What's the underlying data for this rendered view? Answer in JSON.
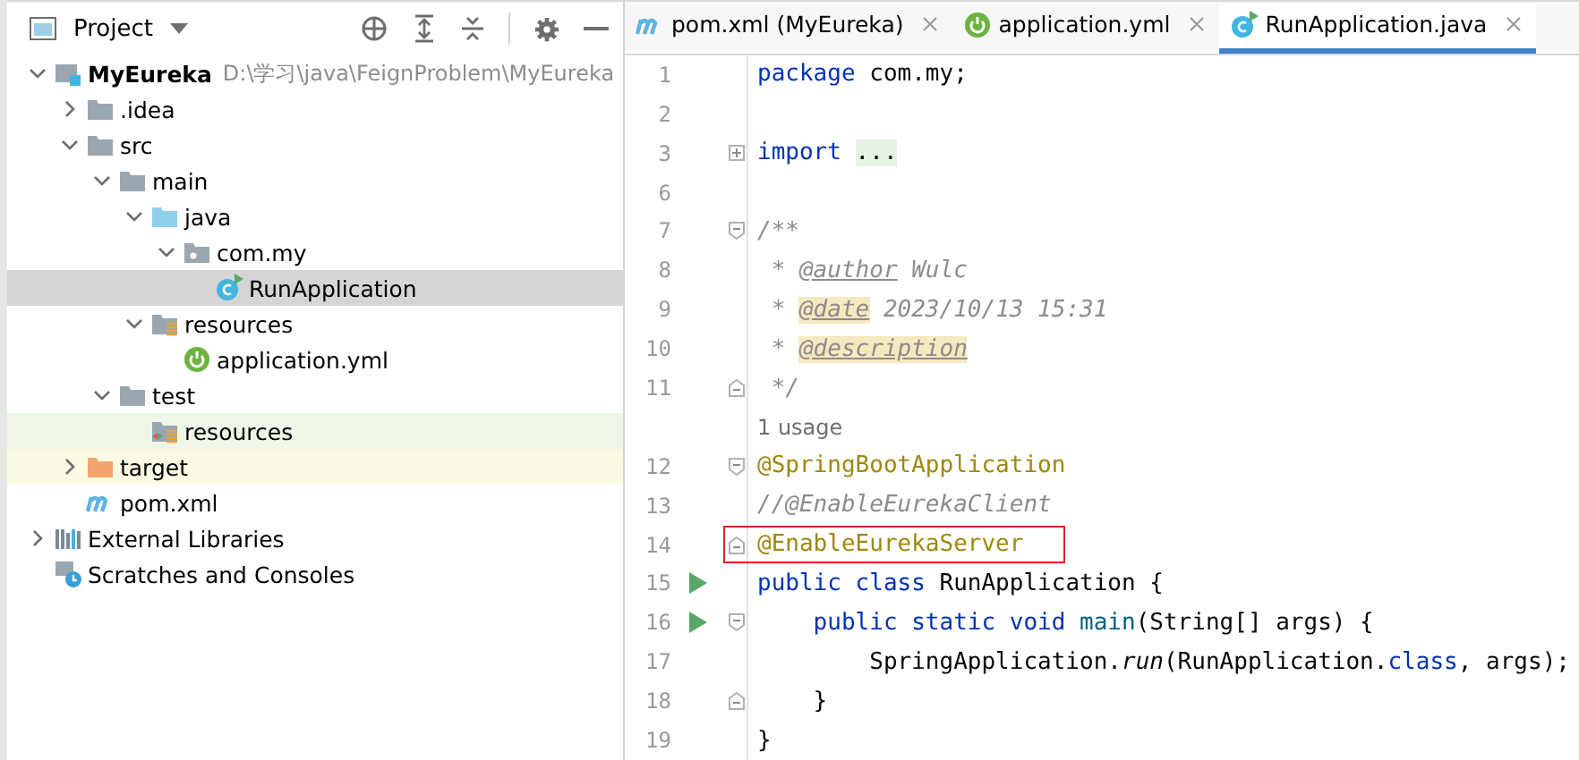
{
  "project_panel": {
    "title": "Project",
    "tree": [
      {
        "label": "MyEureka",
        "kind": "module",
        "hint": "D:\\学习\\java\\FeignProblem\\MyEureka",
        "expanded": true,
        "selected": false,
        "children": [
          {
            "label": ".idea",
            "kind": "folder",
            "expanded": false,
            "selected": false
          },
          {
            "label": "src",
            "kind": "folder",
            "expanded": true,
            "selected": false,
            "children": [
              {
                "label": "main",
                "kind": "folder",
                "expanded": true,
                "selected": false,
                "children": [
                  {
                    "label": "java",
                    "kind": "source-folder",
                    "expanded": true,
                    "selected": false,
                    "children": [
                      {
                        "label": "com.my",
                        "kind": "package",
                        "expanded": true,
                        "selected": false,
                        "children": [
                          {
                            "label": "RunApplication",
                            "kind": "class",
                            "selected": true
                          }
                        ]
                      }
                    ]
                  },
                  {
                    "label": "resources",
                    "kind": "resources",
                    "expanded": true,
                    "selected": false,
                    "children": [
                      {
                        "label": "application.yml",
                        "kind": "spring",
                        "selected": false
                      }
                    ]
                  }
                ]
              },
              {
                "label": "test",
                "kind": "folder",
                "expanded": true,
                "selected": false,
                "children": [
                  {
                    "label": "resources",
                    "kind": "test-resources",
                    "selected": false
                  }
                ]
              }
            ]
          },
          {
            "label": "target",
            "kind": "excluded",
            "expanded": false,
            "selected": false
          },
          {
            "label": "pom.xml",
            "kind": "maven",
            "selected": false
          }
        ]
      },
      {
        "label": "External Libraries",
        "kind": "libraries",
        "expanded": false,
        "selected": false
      },
      {
        "label": "Scratches and Consoles",
        "kind": "scratches",
        "selected": false
      }
    ]
  },
  "tabs": [
    {
      "label": "pom.xml (MyEureka)",
      "kind": "maven",
      "selected": false
    },
    {
      "label": "application.yml",
      "kind": "spring",
      "selected": false
    },
    {
      "label": "RunApplication.java",
      "kind": "class",
      "selected": true
    }
  ],
  "editor": {
    "lines": [
      {
        "kind": "code",
        "number": "1",
        "run": false,
        "fold_start": false,
        "fold_end": false,
        "tokens": [
          {
            "kind": "keyword",
            "text": "package"
          },
          {
            "kind": "plain",
            "text": " com.my;"
          }
        ]
      },
      {
        "kind": "code",
        "number": "2",
        "run": false,
        "fold_start": false,
        "fold_end": false
      },
      {
        "kind": "code",
        "number": "3",
        "run": false,
        "fold_start": true,
        "fold_end": false,
        "collapsed": true,
        "tokens": [
          {
            "kind": "keyword",
            "text": "import "
          },
          {
            "kind": "folded",
            "text": "..."
          }
        ]
      },
      {
        "kind": "code",
        "number": "6",
        "run": false,
        "fold_start": false,
        "fold_end": false
      },
      {
        "kind": "code",
        "number": "7",
        "run": false,
        "fold_start": true,
        "fold_end": false,
        "collapsed": false,
        "tokens": [
          {
            "kind": "comment",
            "text": "/**"
          }
        ]
      },
      {
        "kind": "code",
        "number": "8",
        "run": false,
        "fold_start": false,
        "fold_end": false,
        "tokens": [
          {
            "kind": "comment",
            "text": " * "
          },
          {
            "kind": "doc-tag",
            "text": "@author"
          },
          {
            "kind": "comment",
            "text": " Wulc"
          }
        ]
      },
      {
        "kind": "code",
        "number": "9",
        "run": false,
        "fold_start": false,
        "fold_end": false,
        "tokens": [
          {
            "kind": "comment",
            "text": " * "
          },
          {
            "kind": "doc-tag-marked",
            "text": "@date"
          },
          {
            "kind": "comment",
            "text": " 2023/10/13 15:31"
          }
        ]
      },
      {
        "kind": "code",
        "number": "10",
        "run": false,
        "fold_start": false,
        "fold_end": false,
        "tokens": [
          {
            "kind": "comment",
            "text": " * "
          },
          {
            "kind": "doc-tag-marked",
            "text": "@description"
          }
        ]
      },
      {
        "kind": "code",
        "number": "11",
        "run": false,
        "fold_start": false,
        "fold_end": true,
        "tokens": [
          {
            "kind": "comment",
            "text": " */"
          }
        ]
      },
      {
        "kind": "hint",
        "text": "1 usage"
      },
      {
        "kind": "code",
        "number": "12",
        "run": false,
        "fold_start": true,
        "fold_end": false,
        "collapsed": false,
        "tokens": [
          {
            "kind": "annotation",
            "text": "@SpringBootApplication"
          }
        ]
      },
      {
        "kind": "code",
        "number": "13",
        "run": false,
        "fold_start": false,
        "fold_end": false,
        "tokens": [
          {
            "kind": "comment",
            "text": "//@EnableEurekaClient"
          }
        ]
      },
      {
        "kind": "code",
        "number": "14",
        "run": false,
        "fold_start": false,
        "fold_end": true,
        "boxed": true,
        "tokens": [
          {
            "kind": "annotation",
            "text": "@EnableEurekaServer"
          }
        ]
      },
      {
        "kind": "code",
        "number": "15",
        "run": true,
        "fold_start": false,
        "fold_end": false,
        "tokens": [
          {
            "kind": "keyword",
            "text": "public class"
          },
          {
            "kind": "plain",
            "text": " RunApplication {"
          }
        ]
      },
      {
        "kind": "code",
        "number": "16",
        "run": true,
        "fold_start": true,
        "fold_end": false,
        "collapsed": false,
        "tokens": [
          {
            "kind": "keyword",
            "text": "    public static void "
          },
          {
            "kind": "method",
            "text": "main"
          },
          {
            "kind": "plain",
            "text": "(String[] args) {"
          }
        ]
      },
      {
        "kind": "code",
        "number": "17",
        "run": false,
        "fold_start": false,
        "fold_end": false,
        "tokens": [
          {
            "kind": "plain",
            "text": "        SpringApplication."
          },
          {
            "kind": "static-call",
            "text": "run"
          },
          {
            "kind": "plain",
            "text": "(RunApplication."
          },
          {
            "kind": "keyword",
            "text": "class"
          },
          {
            "kind": "plain",
            "text": ", args);"
          }
        ]
      },
      {
        "kind": "code",
        "number": "18",
        "run": false,
        "fold_start": false,
        "fold_end": true,
        "tokens": [
          {
            "kind": "plain",
            "text": "    }"
          }
        ]
      },
      {
        "kind": "code",
        "number": "19",
        "run": false,
        "fold_start": false,
        "fold_end": false,
        "tokens": [
          {
            "kind": "plain",
            "text": "}"
          }
        ]
      }
    ]
  }
}
